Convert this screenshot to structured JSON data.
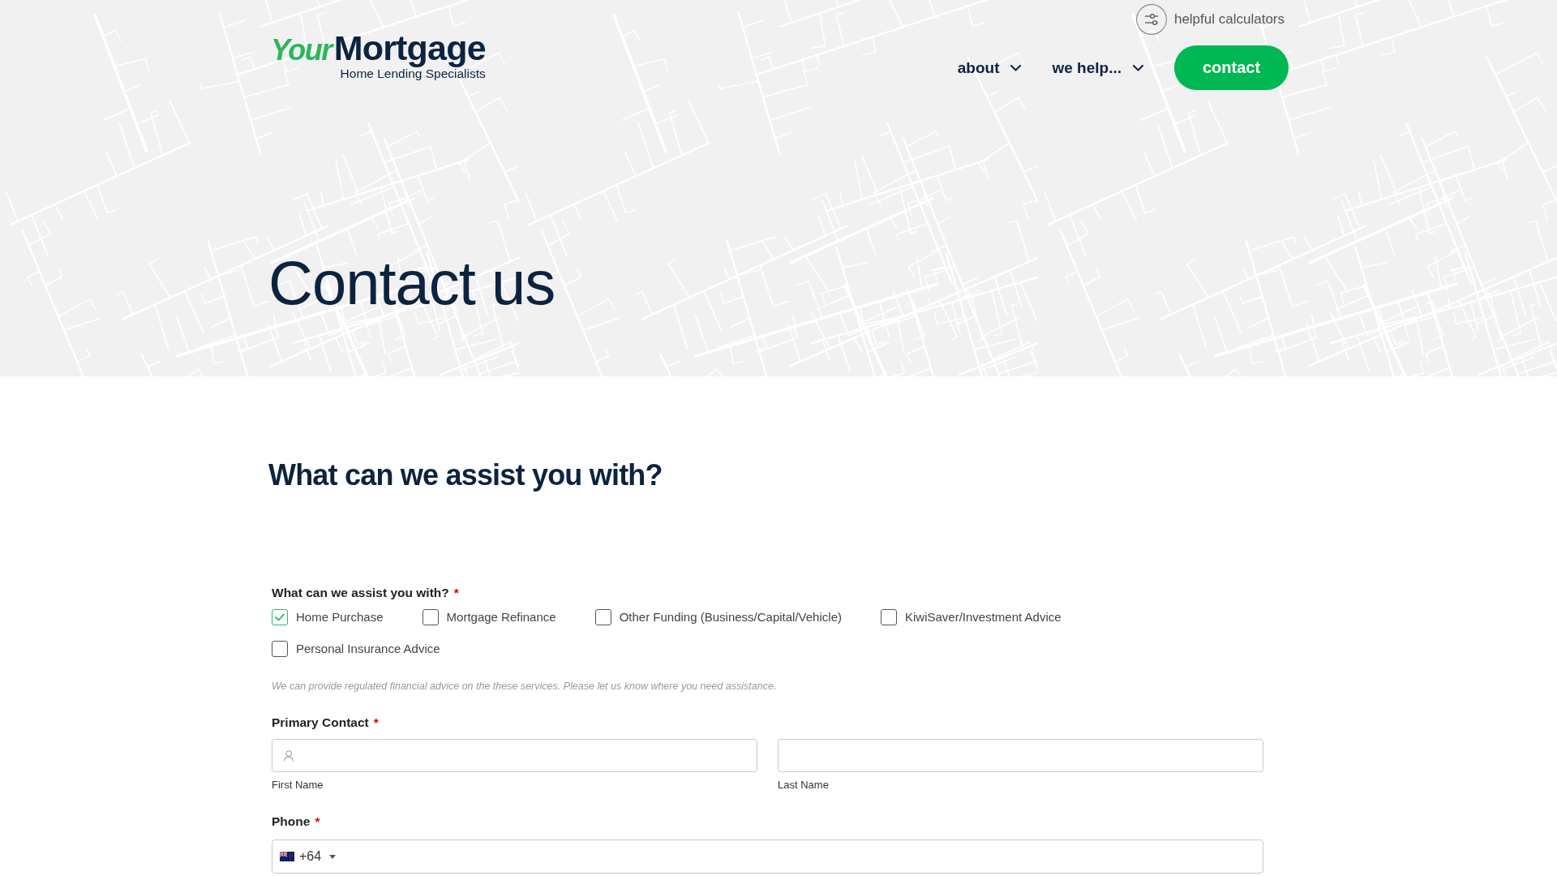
{
  "header": {
    "logo": {
      "script": "Your",
      "wordmark": "Mortgage",
      "tagline": "Home Lending Specialists"
    },
    "utility_link": {
      "label": "helpful calculators"
    },
    "nav": [
      {
        "label": "about",
        "kind": "dropdown"
      },
      {
        "label": "we help...",
        "kind": "dropdown"
      }
    ],
    "cta": {
      "label": "contact"
    }
  },
  "hero": {
    "title": "Contact us"
  },
  "section": {
    "heading": "What can we assist you with?"
  },
  "form": {
    "assist": {
      "label": "What can we assist you with?",
      "required_mark": "*",
      "options": [
        {
          "label": "Home Purchase",
          "checked": true
        },
        {
          "label": "Mortgage Refinance",
          "checked": false
        },
        {
          "label": "Other Funding (Business/Capital/Vehicle)",
          "checked": false
        },
        {
          "label": "KiwiSaver/Investment Advice",
          "checked": false
        },
        {
          "label": "Personal Insurance Advice",
          "checked": false
        }
      ],
      "hint": "We can provide regulated financial advice on the these services. Please let us know where you need assistance."
    },
    "primary_contact": {
      "label": "Primary Contact",
      "required_mark": "*",
      "fields": [
        {
          "caption": "First Name",
          "kind": "prefixed"
        },
        {
          "caption": "Last Name",
          "kind": "plain"
        }
      ]
    },
    "phone": {
      "label": "Phone",
      "required_mark": "*",
      "country_code": "+64"
    }
  }
}
